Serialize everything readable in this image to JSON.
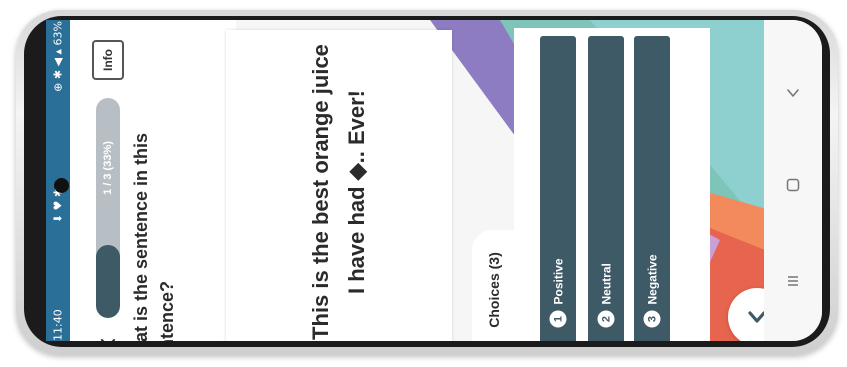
{
  "status_bar": {
    "time": "11:40",
    "left_icons": "⬇ ♥ ✱ •",
    "right_text": "⊕ ✱ ◀ ▴ 63%"
  },
  "app": {
    "info_label": "Info",
    "progress_text": "1 / 3 (33%)",
    "progress_fraction": 0.33,
    "question": "What is the sentence in this sentence?",
    "sentence": "This is the best orange juice I have had ◆.. Ever!",
    "choices_title": "Choices (3)",
    "choices": [
      {
        "num": "1",
        "label": "Positive"
      },
      {
        "num": "2",
        "label": "Neutral"
      },
      {
        "num": "3",
        "label": "Negative"
      }
    ]
  },
  "icons": {
    "back": "chevron-left-icon",
    "submit": "chevron-down-icon",
    "nav_back": "nav-back-icon",
    "nav_home": "nav-home-icon",
    "nav_recents": "nav-recents-icon"
  },
  "colors": {
    "accent": "#3d5a66",
    "status_bar": "#2a6f97",
    "progress_track": "#b8bfc4"
  }
}
